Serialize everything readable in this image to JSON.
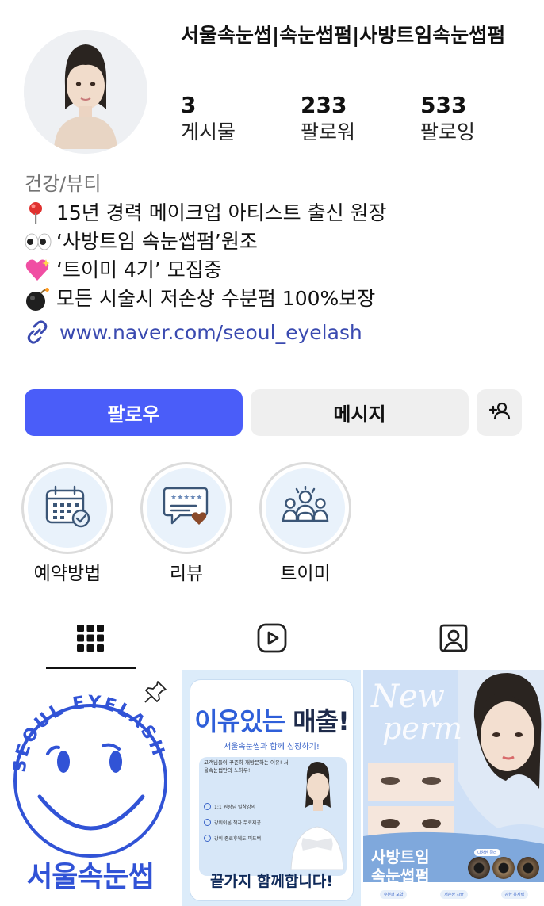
{
  "profile": {
    "name": "서울속눈썹|속눈썹펌|사방트임속눈썹펌",
    "stats": [
      {
        "value": "3",
        "label": "게시물"
      },
      {
        "value": "233",
        "label": "팔로워"
      },
      {
        "value": "533",
        "label": "팔로잉"
      }
    ],
    "category": "건강/뷰티",
    "bio_lines": [
      {
        "icon": "round-pushpin-icon",
        "text": "15년 경력 메이크업 아티스트 출신 원장"
      },
      {
        "icon": "eyes-icon",
        "text": "‘사방트임 속눈썹펌’원조"
      },
      {
        "icon": "sparkling-heart-icon",
        "text": "‘트이미 4기’ 모집중"
      },
      {
        "icon": "bomb-icon",
        "text": "모든 시술시 저손상 수분펌 100%보장"
      }
    ],
    "link": "www.naver.com/seoul_eyelash"
  },
  "actions": {
    "follow_label": "팔로우",
    "message_label": "메시지",
    "add_user_icon": "add-user-icon"
  },
  "highlights": [
    {
      "label": "예약방법",
      "icon": "calendar-check-icon"
    },
    {
      "label": "리뷰",
      "icon": "review-stars-icon"
    },
    {
      "label": "트이미",
      "icon": "group-people-icon"
    }
  ],
  "tabs": [
    {
      "name": "grid",
      "icon": "grid-icon",
      "active": true
    },
    {
      "name": "reels",
      "icon": "reels-icon",
      "active": false
    },
    {
      "name": "tagged",
      "icon": "tagged-user-icon",
      "active": false
    }
  ],
  "posts": {
    "post1": {
      "circle_text": "SEOUL EYELASH",
      "title": "서울속눈썹",
      "pinned": true
    },
    "post2": {
      "headline_accent": "이유있는",
      "headline_rest": " 매출!",
      "subtitle": "서울속눈썹과 함께 성장하기!",
      "intro": "고객님들이 꾸준히 재방문하는 이유! 서울속눈썹만의 노하우!",
      "items": [
        "1:1 원장님 밀착강의",
        "강의이론 책자 무료제공",
        "강의 종료후에도 피드백"
      ],
      "footer": "끝가지 함께합니다!"
    },
    "post3": {
      "script_1": "New",
      "script_2": "perm",
      "heading_1": "사방트임",
      "heading_2": "속눈썹펌",
      "lens_label": "다양한 컬러",
      "chips": [
        "수분퍼 포함",
        "저손상 시술",
        "강한 유지력"
      ]
    }
  },
  "colors": {
    "accent": "#4a5df9",
    "link": "#3a4ab0",
    "secondary_text": "#737373",
    "button_gray": "#efefef",
    "post_blue": "#3153d6"
  }
}
